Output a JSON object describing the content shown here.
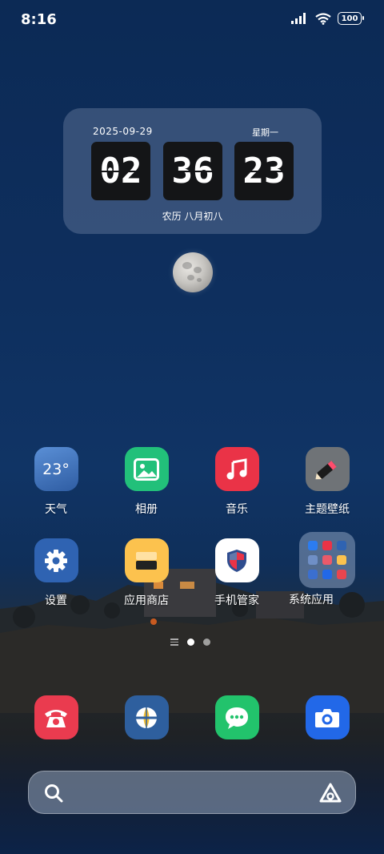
{
  "status_bar": {
    "time": "8:16",
    "battery": "100",
    "icons": [
      "signal-icon",
      "wifi-icon",
      "battery-icon"
    ]
  },
  "clock_widget": {
    "date": "2025-09-29",
    "weekday": "星期一",
    "hours": "02",
    "minutes": "36",
    "seconds": "23",
    "lunar": "农历 八月初八"
  },
  "apps_row1": [
    {
      "label": "天气",
      "icon": "weather-icon",
      "temp": "23°"
    },
    {
      "label": "相册",
      "icon": "gallery-icon"
    },
    {
      "label": "音乐",
      "icon": "music-icon"
    },
    {
      "label": "主题壁纸",
      "icon": "theme-icon"
    }
  ],
  "apps_row2": [
    {
      "label": "设置",
      "icon": "settings-icon"
    },
    {
      "label": "应用商店",
      "icon": "app-store-icon"
    },
    {
      "label": "手机管家",
      "icon": "phone-manager-icon"
    },
    {
      "label": "系统应用",
      "icon": "folder-icon"
    }
  ],
  "dock": [
    {
      "icon": "phone-icon"
    },
    {
      "icon": "browser-icon"
    },
    {
      "icon": "messages-icon"
    },
    {
      "icon": "camera-icon"
    }
  ],
  "colors": {
    "weather": "#3c6fb5",
    "gallery": "#22c07a",
    "music": "#ea3347",
    "theme": "#6f7377",
    "settings": "#2f63b2",
    "store": "#fcc24e",
    "manager": "#ffffff",
    "folder": "rgba(150,170,200,0.5)",
    "phone": "#ea3b4f",
    "browser": "#2e5f9e",
    "messages": "#22c36c",
    "camera": "#2268e8"
  }
}
